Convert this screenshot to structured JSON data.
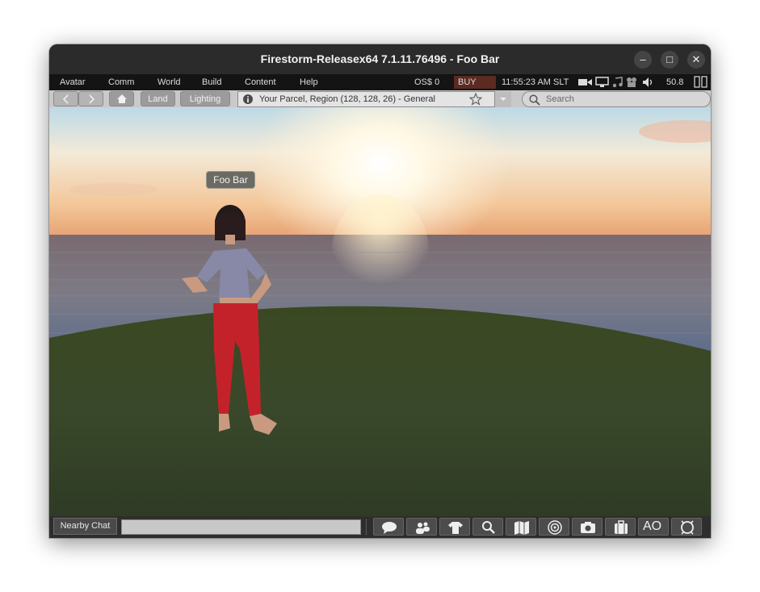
{
  "window": {
    "title": "Firestorm-Releasex64 7.1.11.76496 - Foo Bar",
    "controls": {
      "minimize": "–",
      "maximize": "□",
      "close": "✕"
    }
  },
  "menubar": {
    "items": [
      "Avatar",
      "Comm",
      "World",
      "Build",
      "Content",
      "Help"
    ],
    "balance": "OS$ 0",
    "buy": "BUY OS$",
    "time": "11:55:23 AM SLT",
    "fps": "50.8"
  },
  "navbar": {
    "land_label": "Land",
    "lighting_label": "Lighting",
    "location": "Your Parcel, Region (128, 128, 26) - General",
    "search_placeholder": "Search"
  },
  "scene": {
    "avatar_name": "Foo Bar"
  },
  "bottombar": {
    "chat_label": "Nearby Chat",
    "chat_value": "",
    "ao_label": "AO",
    "toolbar_buttons": [
      "chat-icon",
      "people-icon",
      "appearance-icon",
      "search-icon",
      "map-icon",
      "radar-icon",
      "snapshot-icon",
      "inventory-icon",
      "ao-button",
      "move-icon"
    ]
  },
  "colors": {
    "titlebar": "#2b2b2b",
    "menubar": "#141414",
    "navbar": "#c9c9c9",
    "buy_button": "#5b2a20",
    "sky_top": "#bcd9e6",
    "sun": "#fff7dc",
    "sea": "#6e6a74",
    "grass": "#3b4a26",
    "shirt": "#8a8aa6",
    "pants": "#c4222a"
  }
}
